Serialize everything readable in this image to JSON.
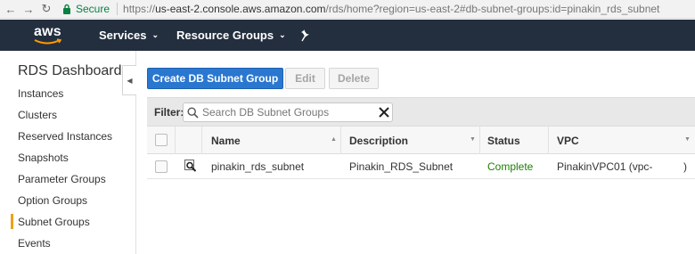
{
  "browser": {
    "secure_label": "Secure",
    "url_prefix": "https://",
    "url_host": "us-east-2.console.aws.amazon.com",
    "url_path": "/rds/home?region=us-east-2#db-subnet-groups:id=pinakin_rds_subnet"
  },
  "aws_nav": {
    "logo_text": "aws",
    "services_label": "Services",
    "resource_groups_label": "Resource Groups",
    "bg_color": "#232f3e"
  },
  "sidebar": {
    "title": "RDS Dashboard",
    "items": [
      {
        "label": "Instances"
      },
      {
        "label": "Clusters"
      },
      {
        "label": "Reserved Instances"
      },
      {
        "label": "Snapshots"
      },
      {
        "label": "Parameter Groups"
      },
      {
        "label": "Option Groups"
      },
      {
        "label": "Subnet Groups",
        "active": true
      },
      {
        "label": "Events"
      }
    ]
  },
  "toolbar": {
    "create_label": "Create DB Subnet Group",
    "edit_label": "Edit",
    "delete_label": "Delete",
    "primary_color": "#2a77d0"
  },
  "filter": {
    "label": "Filter:",
    "placeholder": "Search DB Subnet Groups",
    "value": ""
  },
  "table": {
    "columns": [
      "Name",
      "Description",
      "Status",
      "VPC"
    ],
    "rows": [
      {
        "name": "pinakin_rds_subnet",
        "description": "Pinakin_RDS_Subnet",
        "status": "Complete",
        "vpc": "PinakinVPC01 (vpc-",
        "vpc_suffix": ")"
      }
    ],
    "status_color": "#1d8102"
  }
}
